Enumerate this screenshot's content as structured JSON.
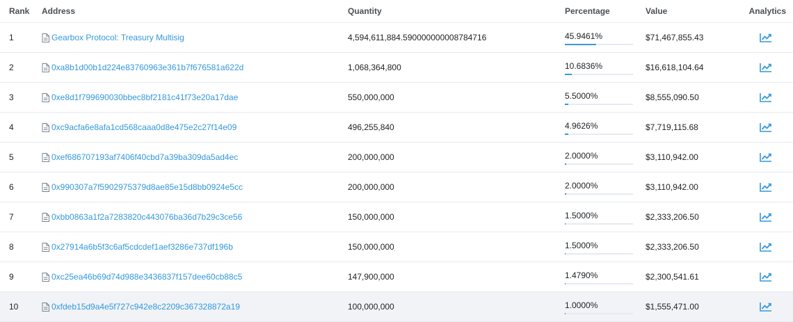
{
  "table": {
    "headers": {
      "rank": "Rank",
      "address": "Address",
      "quantity": "Quantity",
      "percentage": "Percentage",
      "value": "Value",
      "analytics": "Analytics"
    },
    "accent_color": "#3498db",
    "highlight_row_color": "#f1f3f7",
    "rows": [
      {
        "rank": "1",
        "address": "Gearbox Protocol: Treasury Multisig",
        "quantity": "4,594,611,884.590000000008784716",
        "percentage": "45.9461%",
        "pct_fraction": 0.459461,
        "value": "$71,467,855.43",
        "icon": "chart-icon"
      },
      {
        "rank": "2",
        "address": "0xa8b1d00b1d224e83760963e361b7f676581a622d",
        "quantity": "1,068,364,800",
        "percentage": "10.6836%",
        "pct_fraction": 0.106836,
        "value": "$16,618,104.64",
        "icon": "chart-icon"
      },
      {
        "rank": "3",
        "address": "0xe8d1f799690030bbec8bf2181c41f73e20a17dae",
        "quantity": "550,000,000",
        "percentage": "5.5000%",
        "pct_fraction": 0.055,
        "value": "$8,555,090.50",
        "icon": "chart-icon"
      },
      {
        "rank": "4",
        "address": "0xc9acfa6e8afa1cd568caaa0d8e475e2c27f14e09",
        "quantity": "496,255,840",
        "percentage": "4.9626%",
        "pct_fraction": 0.049626,
        "value": "$7,719,115.68",
        "icon": "chart-icon"
      },
      {
        "rank": "5",
        "address": "0xef686707193af7406f40cbd7a39ba309da5ad4ec",
        "quantity": "200,000,000",
        "percentage": "2.0000%",
        "pct_fraction": 0.02,
        "value": "$3,110,942.00",
        "icon": "chart-icon"
      },
      {
        "rank": "6",
        "address": "0x990307a7f5902975379d8ae85e15d8bb0924e5cc",
        "quantity": "200,000,000",
        "percentage": "2.0000%",
        "pct_fraction": 0.02,
        "value": "$3,110,942.00",
        "icon": "chart-icon"
      },
      {
        "rank": "7",
        "address": "0xbb0863a1f2a7283820c443076ba36d7b29c3ce56",
        "quantity": "150,000,000",
        "percentage": "1.5000%",
        "pct_fraction": 0.015,
        "value": "$2,333,206.50",
        "icon": "chart-icon"
      },
      {
        "rank": "8",
        "address": "0x27914a6b5f3c6af5cdcdef1aef3286e737df196b",
        "quantity": "150,000,000",
        "percentage": "1.5000%",
        "pct_fraction": 0.015,
        "value": "$2,333,206.50",
        "icon": "chart-icon"
      },
      {
        "rank": "9",
        "address": "0xc25ea46b69d74d988e3436837f157dee60cb88c5",
        "quantity": "147,900,000",
        "percentage": "1.4790%",
        "pct_fraction": 0.01479,
        "value": "$2,300,541.61",
        "icon": "chart-icon"
      },
      {
        "rank": "10",
        "address": "0xfdeb15d9a4e5f727c942e8c2209c367328872a19",
        "quantity": "100,000,000",
        "percentage": "1.0000%",
        "pct_fraction": 0.01,
        "value": "$1,555,471.00",
        "icon": "chart-icon"
      }
    ]
  }
}
